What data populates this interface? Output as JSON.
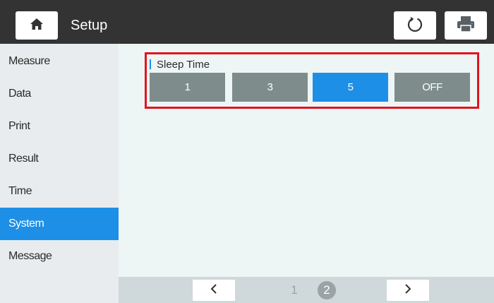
{
  "header": {
    "title": "Setup",
    "home_icon": "home-icon",
    "refresh_icon": "refresh-icon",
    "print_icon": "printer-icon"
  },
  "sidebar": {
    "items": [
      {
        "label": "Measure"
      },
      {
        "label": "Data"
      },
      {
        "label": "Print"
      },
      {
        "label": "Result"
      },
      {
        "label": "Time"
      },
      {
        "label": "System",
        "active": true
      },
      {
        "label": "Message"
      }
    ]
  },
  "main": {
    "sleep_time": {
      "label": "Sleep Time",
      "options": [
        "1",
        "3",
        "5",
        "OFF"
      ],
      "selected": "5"
    }
  },
  "pagination": {
    "pages": [
      "1",
      "2"
    ],
    "current": "2",
    "prev_icon": "chevron-left-icon",
    "next_icon": "chevron-right-icon"
  },
  "colors": {
    "accent": "#1e8fe6",
    "highlight_border": "#e0151f",
    "option_bg": "#7f8c8c",
    "topbar": "#333333"
  }
}
